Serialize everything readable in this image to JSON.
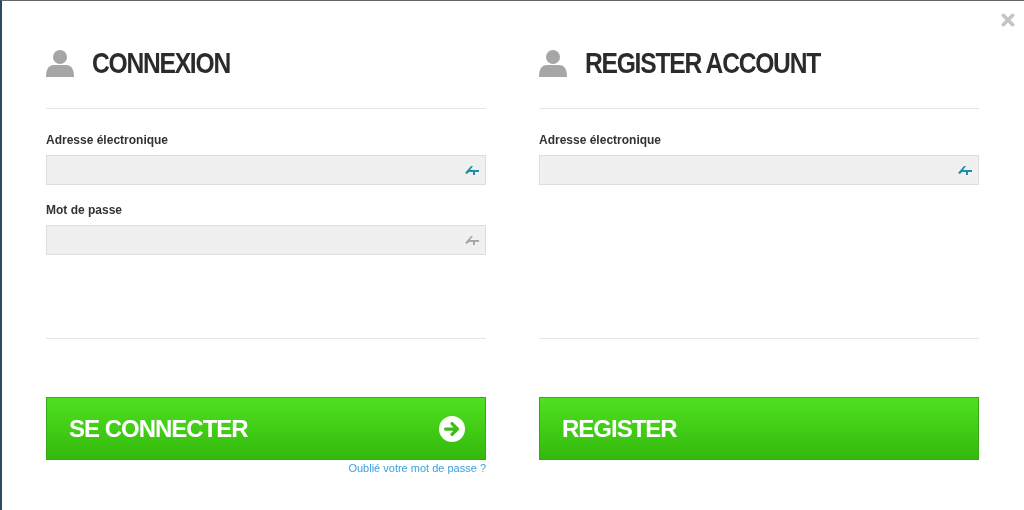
{
  "panels": [
    {
      "title": "CONNEXION",
      "fields": [
        {
          "label": "Adresse électronique",
          "color": "#1f8ea3"
        },
        {
          "label": "Mot de passe",
          "color": "#a8a8a8"
        }
      ],
      "button": {
        "label": "SE CONNECTER",
        "arrow_icon": true
      },
      "link": "Oublié votre mot de passe ?"
    },
    {
      "title": "REGISTER ACCOUNT",
      "fields": [
        {
          "label": "Adresse électronique",
          "color": "#1f8ea3"
        }
      ],
      "button": {
        "label": "REGISTER",
        "arrow_icon": false
      }
    }
  ]
}
